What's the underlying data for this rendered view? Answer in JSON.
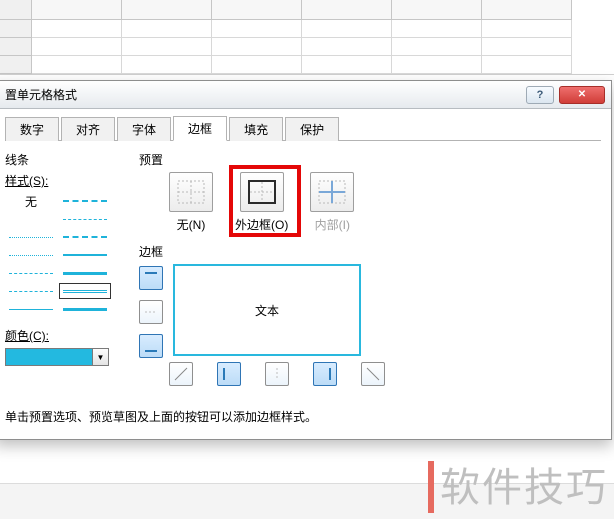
{
  "dialog": {
    "title": "置单元格格式",
    "help_icon": "?",
    "close_icon": "✕"
  },
  "tabs": {
    "number": "数字",
    "align": "对齐",
    "font": "字体",
    "border": "边框",
    "fill": "填充",
    "protect": "保护"
  },
  "line": {
    "group": "线条",
    "style_label": "样式(S):",
    "none": "无"
  },
  "color": {
    "label": "颜色(C):",
    "value": "#23b9e0",
    "chevron": "▼"
  },
  "presets": {
    "group": "预置",
    "none": "无(N)",
    "outline": "外边框(O)",
    "inside": "内部(I)"
  },
  "border": {
    "group": "边框",
    "preview_text": "文本"
  },
  "hint": "单击预置选项、预览草图及上面的按钮可以添加边框样式。",
  "watermark": "软件技巧"
}
